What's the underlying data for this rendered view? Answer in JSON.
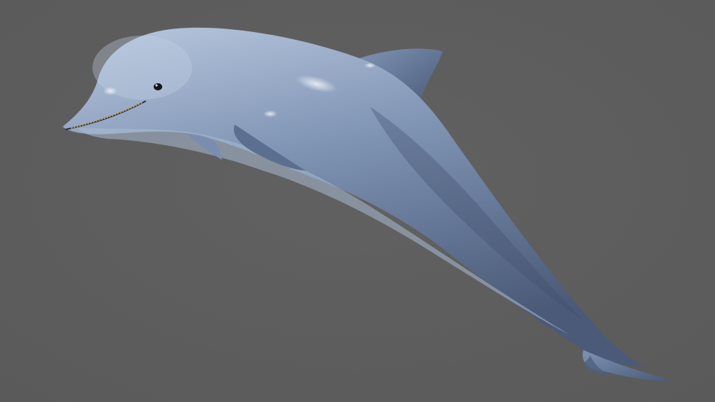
{
  "scene": {
    "subject_icon": "dolphin-icon",
    "colors": {
      "background": "#5a5a5a",
      "body_light": "#b8c8de",
      "body_mid": "#7f93b3",
      "body_dark": "#4a5a78",
      "belly": "#a9bbd3",
      "eye": "#111418",
      "teeth": "#c9a24a"
    }
  }
}
